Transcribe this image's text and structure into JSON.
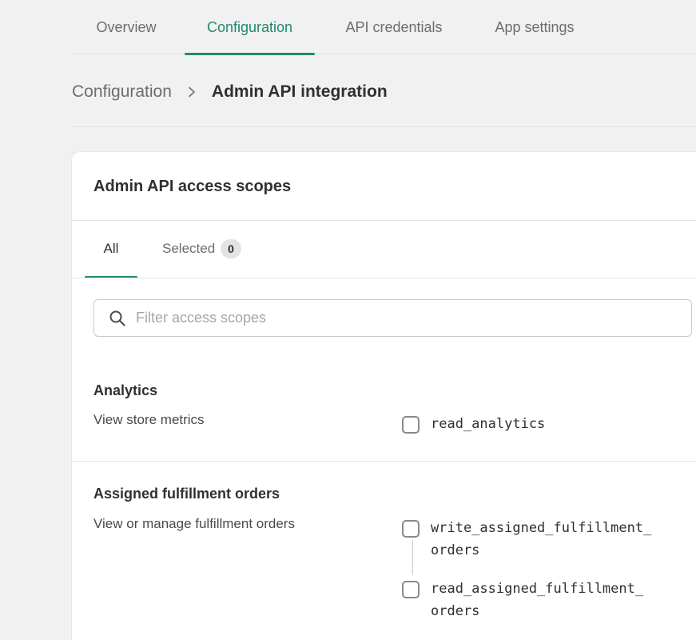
{
  "top_tabs": [
    {
      "label": "Overview",
      "active": false
    },
    {
      "label": "Configuration",
      "active": true
    },
    {
      "label": "API credentials",
      "active": false
    },
    {
      "label": "App settings",
      "active": false
    }
  ],
  "breadcrumb": {
    "parent": "Configuration",
    "current": "Admin API integration",
    "separator_icon": "chevron-right-icon"
  },
  "card": {
    "title": "Admin API access scopes",
    "tabs": {
      "all_label": "All",
      "selected_label": "Selected",
      "selected_count": "0"
    },
    "search": {
      "placeholder": "Filter access scopes",
      "value": "",
      "icon": "search-icon"
    },
    "sections": [
      {
        "title": "Analytics",
        "description": "View store metrics",
        "scopes": [
          {
            "label": "read_analytics",
            "checked": false
          }
        ]
      },
      {
        "title": "Assigned fulfillment orders",
        "description": "View or manage fulfillment orders",
        "scopes": [
          {
            "label_line1": "write_assigned_fulfillment_",
            "label_line2": "orders",
            "checked": false
          },
          {
            "label_line1": "read_assigned_fulfillment_",
            "label_line2": "orders",
            "checked": false
          }
        ]
      }
    ]
  },
  "colors": {
    "accent": "#1f8a6f",
    "page_bg": "#f1f1f1",
    "card_bg": "#ffffff",
    "muted_text": "#6d6d6d"
  }
}
